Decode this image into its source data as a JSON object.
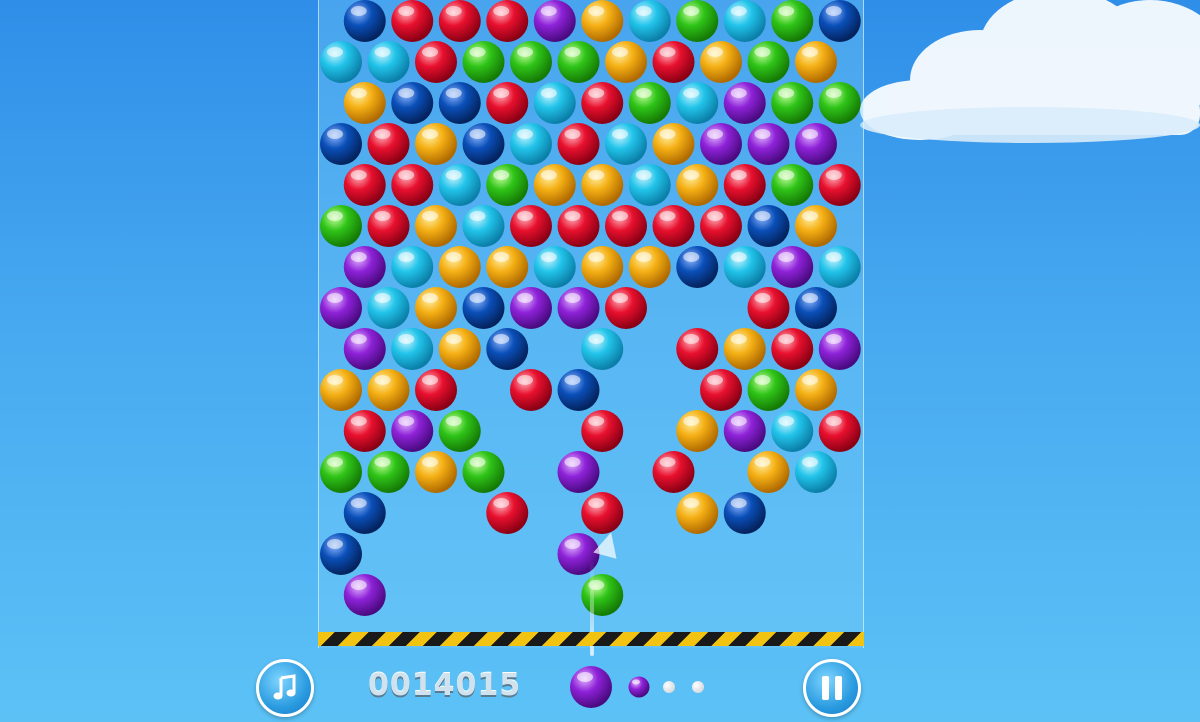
{
  "hud": {
    "score": "0014015",
    "music_icon": "music-note-icon",
    "pause_icon": "pause-icon"
  },
  "launcher": {
    "current_bubble_color": "purple",
    "next_bubble_color": "purple",
    "queue_dots": 2
  },
  "palette": {
    "red": "#e8102e",
    "blue": "#0a4fb8",
    "cyan": "#22c4ea",
    "green": "#2fc418",
    "yellow": "#f5b015",
    "purple": "#8e22d8"
  },
  "grid": {
    "rows": [
      {
        "indent": 1,
        "cells": [
          "B",
          "R",
          "R",
          "R",
          "P",
          "Y",
          "C",
          "G",
          "C",
          "G",
          "B"
        ]
      },
      {
        "indent": 0,
        "cells": [
          "C",
          "C",
          "R",
          "G",
          "G",
          "G",
          "Y",
          "R",
          "Y",
          "G",
          "Y"
        ]
      },
      {
        "indent": 1,
        "cells": [
          "Y",
          "B",
          "B",
          "R",
          "C",
          "R",
          "G",
          "C",
          "P",
          "G",
          "G"
        ]
      },
      {
        "indent": 0,
        "cells": [
          "B",
          "R",
          "Y",
          "B",
          "C",
          "R",
          "C",
          "Y",
          "P",
          "P",
          "P"
        ]
      },
      {
        "indent": 1,
        "cells": [
          "R",
          "R",
          "C",
          "G",
          "Y",
          "Y",
          "C",
          "Y",
          "R",
          "G",
          "R"
        ]
      },
      {
        "indent": 0,
        "cells": [
          "G",
          "R",
          "Y",
          "C",
          "R",
          "R",
          "R",
          "R",
          "R",
          "B",
          "Y"
        ]
      },
      {
        "indent": 1,
        "cells": [
          "P",
          "C",
          "Y",
          "Y",
          "C",
          "Y",
          "Y",
          "B",
          "C",
          "P",
          "C"
        ]
      },
      {
        "indent": 0,
        "cells": [
          "P",
          "C",
          "Y",
          "B",
          "P",
          "P",
          "R",
          "-",
          "-",
          "R",
          "B"
        ]
      },
      {
        "indent": 1,
        "cells": [
          "P",
          "C",
          "Y",
          "B",
          "-",
          "C",
          "-",
          "R",
          "Y",
          "R",
          "P"
        ]
      },
      {
        "indent": 0,
        "cells": [
          "Y",
          "Y",
          "R",
          "-",
          "R",
          "B",
          "-",
          "-",
          "R",
          "G",
          "Y"
        ]
      },
      {
        "indent": 1,
        "cells": [
          "R",
          "P",
          "G",
          "-",
          "-",
          "R",
          "-",
          "Y",
          "P",
          "C",
          "R"
        ]
      },
      {
        "indent": 0,
        "cells": [
          "G",
          "G",
          "Y",
          "G",
          "-",
          "P",
          "-",
          "R",
          "-",
          "Y",
          "C"
        ]
      },
      {
        "indent": 1,
        "cells": [
          "B",
          "-",
          "-",
          "R",
          "-",
          "R",
          "-",
          "Y",
          "B",
          "-",
          "-"
        ]
      },
      {
        "indent": 0,
        "cells": [
          "B",
          "-",
          "-",
          "-",
          "-",
          "P",
          "-",
          "-",
          "-",
          "-",
          "-"
        ]
      },
      {
        "indent": 1,
        "cells": [
          "P",
          "-",
          "-",
          "-",
          "-",
          "G",
          "-",
          "-",
          "-",
          "-",
          "-"
        ]
      }
    ]
  }
}
